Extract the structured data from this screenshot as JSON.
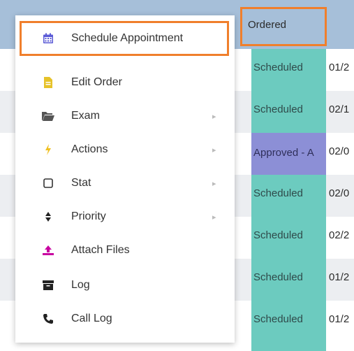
{
  "grid": {
    "header": {
      "column_label": "Ordered"
    },
    "rows": [
      {
        "status": "Scheduled",
        "date": "01/2"
      },
      {
        "status": "Scheduled",
        "date": "02/1"
      },
      {
        "status": "Approved - A",
        "date": "02/0"
      },
      {
        "status": "Scheduled",
        "date": "02/0"
      },
      {
        "status": "Scheduled",
        "date": "02/2"
      },
      {
        "status": "Scheduled",
        "date": "01/2"
      },
      {
        "status": "Scheduled",
        "date": "01/2"
      }
    ]
  },
  "menu": {
    "items": [
      {
        "label": "Schedule Appointment",
        "icon": "calendar-icon",
        "has_submenu": false
      },
      {
        "label": "Edit Order",
        "icon": "document-icon",
        "has_submenu": false
      },
      {
        "label": "Exam",
        "icon": "folder-open-icon",
        "has_submenu": true
      },
      {
        "label": "Actions",
        "icon": "lightning-icon",
        "has_submenu": true
      },
      {
        "label": "Stat",
        "icon": "checkbox-icon",
        "has_submenu": true
      },
      {
        "label": "Priority",
        "icon": "sort-icon",
        "has_submenu": true
      },
      {
        "label": "Attach Files",
        "icon": "upload-icon",
        "has_submenu": false
      },
      {
        "label": "Log",
        "icon": "archive-icon",
        "has_submenu": false
      },
      {
        "label": "Call Log",
        "icon": "phone-icon",
        "has_submenu": false
      }
    ],
    "submenu_chevron": "▸"
  },
  "colors": {
    "header_bg": "#a6bfd9",
    "status_scheduled": "#6ccbbf",
    "status_approved": "#8c8fd6",
    "highlight_border": "#f07f2c",
    "calendar_icon": "#5b5bd6",
    "document_icon": "#e6c229",
    "lightning_icon": "#f0c020",
    "upload_icon": "#c800a0"
  }
}
